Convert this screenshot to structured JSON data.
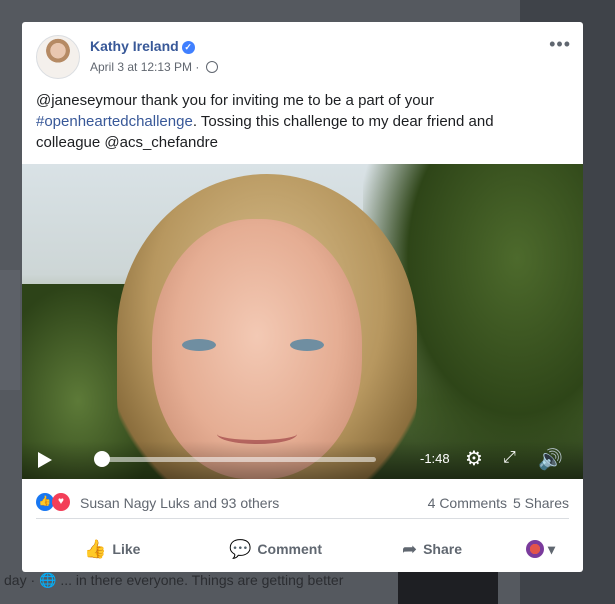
{
  "post": {
    "author": "Kathy Ireland",
    "timestamp": "April 3 at 12:13 PM · ",
    "more": "•••",
    "caption_mention": "@janeseymour",
    "caption_part1": " thank you for inviting me to be a part of your ",
    "hashtag": "#openheartedchallenge",
    "caption_part2": ". Tossing this challenge to my dear friend and colleague @acs_chefandre"
  },
  "video": {
    "remaining_time": "-1:48",
    "progress_fraction": 0.02
  },
  "stats": {
    "reaction_names": "Susan Nagy Luks and 93 others",
    "comments": "4 Comments",
    "shares": "5 Shares"
  },
  "actions": {
    "like": "Like",
    "comment": "Comment",
    "share": "Share"
  },
  "background": {
    "bottom_text": "day · 🌐 ... in there everyone. Things are getting better"
  },
  "colors": {
    "link": "#385898",
    "like_blue": "#1877f2",
    "love_red": "#f33e58"
  },
  "icons": [
    "verified-badge-icon",
    "globe-icon",
    "more-options-icon",
    "play-icon",
    "settings-gear-icon",
    "fullscreen-icon",
    "volume-icon",
    "like-reaction-icon",
    "love-reaction-icon",
    "thumbs-up-icon",
    "comment-bubble-icon",
    "share-arrow-icon",
    "chevron-down-icon"
  ]
}
